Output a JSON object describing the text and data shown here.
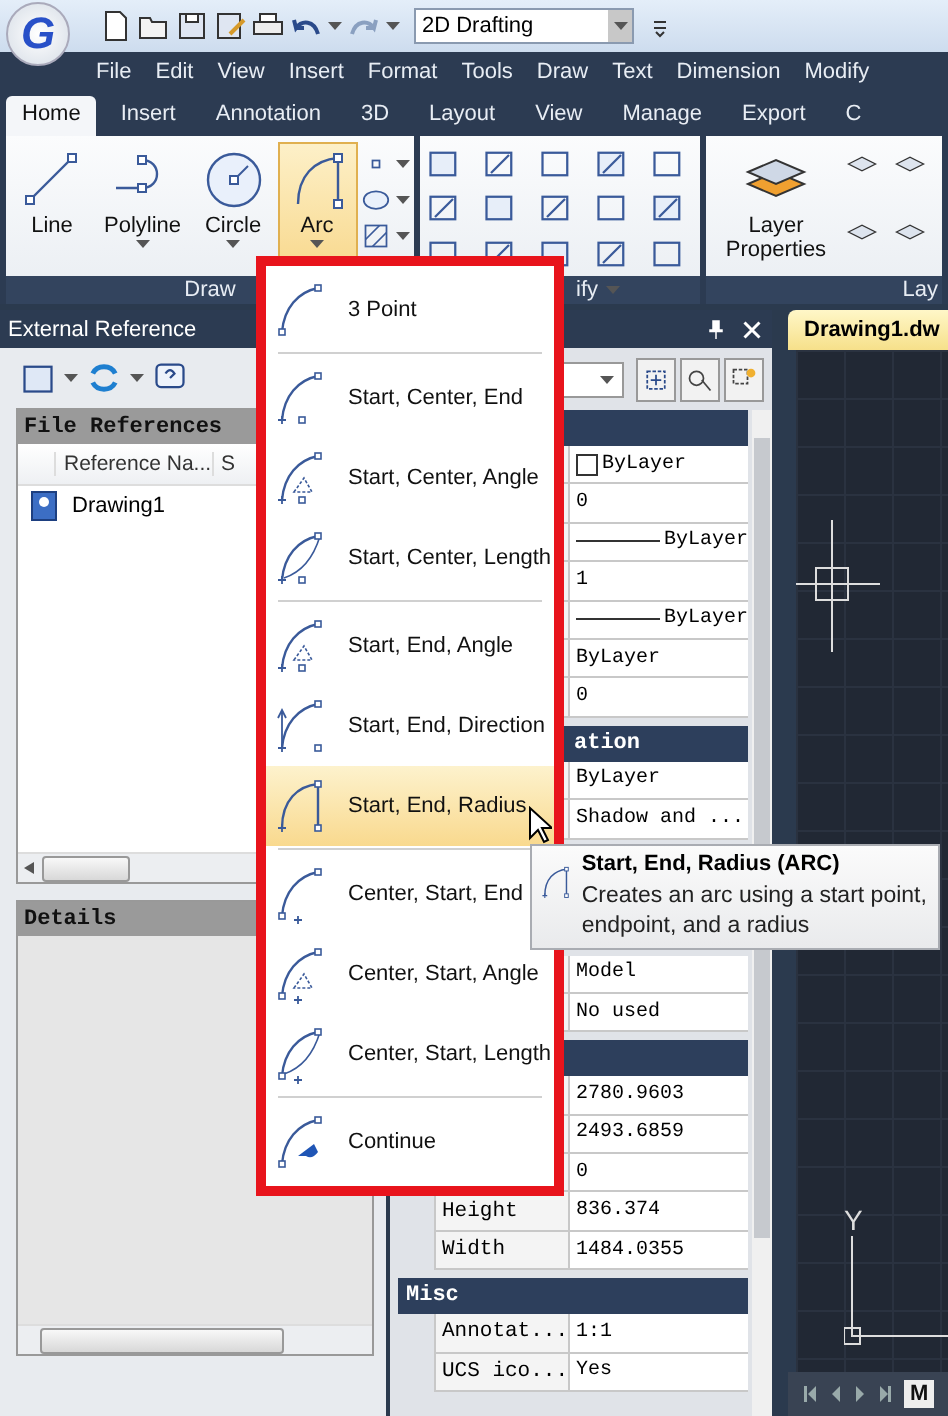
{
  "app_logo_letter": "G",
  "workspace": {
    "value": "2D Drafting"
  },
  "menu_bar": [
    "File",
    "Edit",
    "View",
    "Insert",
    "Format",
    "Tools",
    "Draw",
    "Text",
    "Dimension",
    "Modify"
  ],
  "ribbon_tabs": [
    {
      "label": "Home",
      "selected": true
    },
    {
      "label": "Insert",
      "selected": false
    },
    {
      "label": "Annotation",
      "selected": false
    },
    {
      "label": "3D",
      "selected": false
    },
    {
      "label": "Layout",
      "selected": false
    },
    {
      "label": "View",
      "selected": false
    },
    {
      "label": "Manage",
      "selected": false
    },
    {
      "label": "Export",
      "selected": false
    },
    {
      "label": "C",
      "selected": false
    }
  ],
  "ribbon": {
    "draw_group": {
      "title": "Draw",
      "buttons": [
        {
          "label": "Line",
          "has_caret": false,
          "selected": false
        },
        {
          "label": "Polyline",
          "has_caret": true,
          "selected": false
        },
        {
          "label": "Circle",
          "has_caret": true,
          "selected": false
        },
        {
          "label": "Arc",
          "has_caret": true,
          "selected": true
        }
      ]
    },
    "modify_group": {
      "title": "ify"
    },
    "layer_group": {
      "title": "Lay",
      "button": "Layer Properties"
    }
  },
  "external_reference": {
    "title": "External Reference",
    "file_references": {
      "title": "File References",
      "columns": [
        "Reference Na...",
        "S"
      ],
      "rows": [
        "Drawing1"
      ]
    },
    "details": {
      "title": "Details"
    }
  },
  "properties": {
    "sections": [
      {
        "rows": [
          {
            "kind": "color",
            "value": "ByLayer"
          },
          {
            "kind": "text",
            "value": "0"
          },
          {
            "kind": "linetype",
            "value": "ByLayer"
          },
          {
            "kind": "text",
            "value": "1"
          },
          {
            "kind": "linetype",
            "value": "ByLayer"
          },
          {
            "kind": "text",
            "value": "ByLayer"
          },
          {
            "kind": "text",
            "value": "0"
          }
        ]
      },
      {
        "title": "ation",
        "rows": [
          {
            "kind": "text",
            "value": "ByLayer"
          },
          {
            "kind": "text",
            "value": "Shadow and ..."
          },
          {
            "kind": "text",
            "value": "Model"
          },
          {
            "kind": "text",
            "value": "No used"
          }
        ]
      },
      {
        "rows": [
          {
            "kind": "text",
            "value": "2780.9603"
          },
          {
            "kind": "text",
            "value": "2493.6859"
          },
          {
            "kind": "text",
            "value": "0"
          },
          {
            "kind": "text",
            "label": "Height",
            "value": "836.374"
          },
          {
            "kind": "text",
            "label": "Width",
            "value": "1484.0355"
          }
        ]
      },
      {
        "title": "Misc",
        "rows": [
          {
            "kind": "text",
            "label": "Annotat...",
            "value": "1:1"
          },
          {
            "kind": "text",
            "label": "UCS ico...",
            "value": "Yes"
          }
        ]
      }
    ]
  },
  "drawing": {
    "tab": "Drawing1.dw",
    "ucs_label": "Y",
    "layout_tab": "M"
  },
  "arc_menu": {
    "groups": [
      [
        {
          "label": "3 Point",
          "selected": false
        }
      ],
      [
        {
          "label": "Start, Center, End",
          "selected": false
        },
        {
          "label": "Start, Center, Angle",
          "selected": false
        },
        {
          "label": "Start, Center, Length",
          "selected": false
        }
      ],
      [
        {
          "label": "Start, End, Angle",
          "selected": false
        },
        {
          "label": "Start, End, Direction",
          "selected": false
        },
        {
          "label": "Start, End, Radius",
          "selected": true
        }
      ],
      [
        {
          "label": "Center, Start, End",
          "selected": false
        },
        {
          "label": "Center, Start, Angle",
          "selected": false
        },
        {
          "label": "Center, Start, Length",
          "selected": false
        }
      ],
      [
        {
          "label": "Continue",
          "selected": false
        }
      ]
    ]
  },
  "tooltip": {
    "title": "Start, End, Radius (ARC)",
    "description": "Creates an arc using a start point, endpoint, and a radius"
  }
}
